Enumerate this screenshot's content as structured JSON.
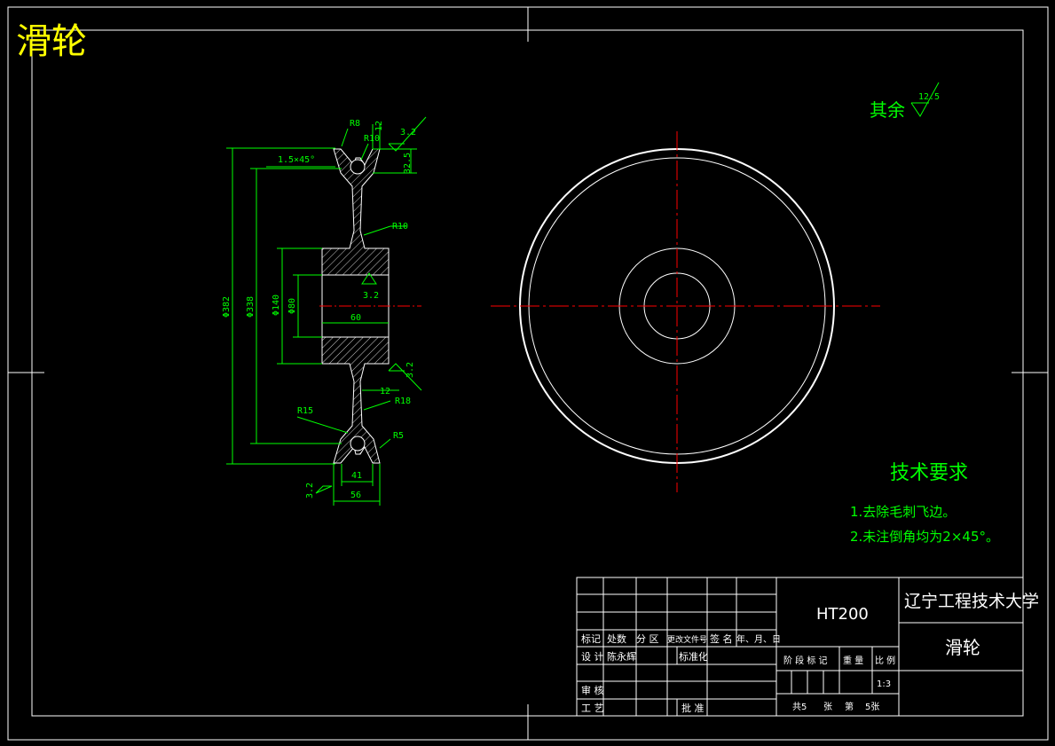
{
  "title": "滑轮",
  "colors": {
    "background": "#000000",
    "frame": "#ffffff",
    "dimension": "#00ff00",
    "centerline": "#ff0000",
    "title_yellow": "#ffff00"
  },
  "roughness_general": {
    "label": "其余",
    "value": "12.5"
  },
  "section_view": {
    "dims": {
      "r8": "R8",
      "r10_top": "R10",
      "d12_top": "12",
      "rough_32_top": "3.2",
      "chamfer": "1.5×45°",
      "d32_5": "32.5",
      "r10_mid": "R10",
      "rough_32_center": "3.2",
      "d60": "60",
      "phi382": "Φ382",
      "phi338": "Φ338",
      "phi140": "Φ140",
      "phi80": "Φ80",
      "rough_32_right": "3.2",
      "d12_bottom": "12",
      "r18": "R18",
      "r15": "R15",
      "r5": "R5",
      "d41": "41",
      "d56": "56",
      "rough_32_bottom": "3.2"
    }
  },
  "tech_requirements": {
    "heading": "技术要求",
    "items": [
      "1.去除毛刺飞边。",
      "2.未注倒角均为2×45°。"
    ]
  },
  "title_block": {
    "material": "HT200",
    "university": "辽宁工程技术大学",
    "part_name": "滑轮",
    "headers": [
      "标记",
      "处数",
      "分 区",
      "更改文件号",
      "签 名",
      "年、月、日"
    ],
    "design_label": "设 计",
    "designer": "陈永辉",
    "standard_label": "标准化",
    "review_label": "审 核",
    "process_label": "工 艺",
    "approve_label": "批 准",
    "stage_label": "阶 段 标 记",
    "weight_label": "重 量",
    "scale_label": "比 例",
    "scale": "1:3",
    "sheets_total_label": "共5",
    "sheets_unit": "张",
    "sheet_no_label": "第",
    "sheet_no": "5张"
  }
}
